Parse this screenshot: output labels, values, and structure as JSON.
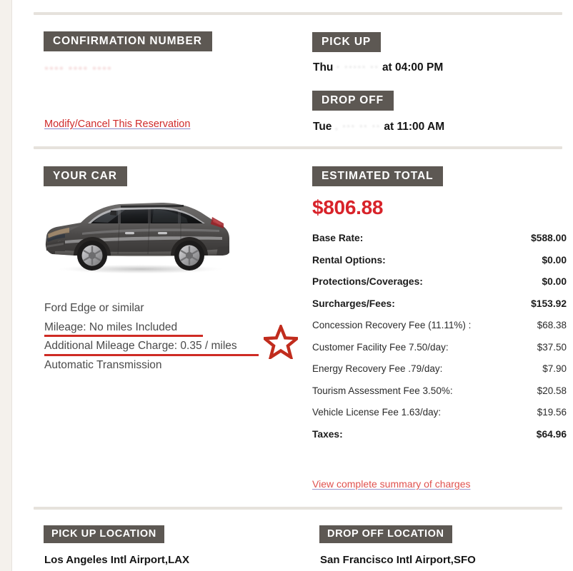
{
  "confirmation": {
    "badge_label": "CONFIRMATION NUMBER",
    "number_redacted": "•••• •••• ••••",
    "modify_link": "Modify/Cancel This Reservation"
  },
  "pickup": {
    "badge_label": "PICK UP",
    "weekday": "Thu",
    "date_redacted": "·  ····· ··",
    "time_text": "at 04:00 PM"
  },
  "dropoff": {
    "badge_label": "DROP OFF",
    "weekday": "Tue",
    "date_redacted": ".  ···  ·· ··",
    "time_text": "at 11:00 AM"
  },
  "your_car": {
    "badge_label": "YOUR CAR",
    "image_alt": "car-side-profile-suv",
    "model": "Ford Edge or similar",
    "mileage": "Mileage: No miles Included",
    "additional_mileage": "Additional Mileage Charge: 0.35 / miles",
    "transmission": "Automatic Transmission",
    "annotation_icon": "star-icon"
  },
  "estimated_total": {
    "badge_label": "ESTIMATED TOTAL",
    "total": "$806.88",
    "charges": [
      {
        "label": "Base Rate:",
        "amount": "$588.00",
        "emphasis": "main"
      },
      {
        "label": "Rental Options:",
        "amount": "$0.00",
        "emphasis": "main"
      },
      {
        "label": "Protections/Coverages:",
        "amount": "$0.00",
        "emphasis": "main"
      },
      {
        "label": "Surcharges/Fees:",
        "amount": "$153.92",
        "emphasis": "main"
      },
      {
        "label": "Concession Recovery Fee (11.11%) :",
        "amount": "$68.38",
        "emphasis": "sub"
      },
      {
        "label": "Customer Facility Fee 7.50/day:",
        "amount": "$37.50",
        "emphasis": "sub"
      },
      {
        "label": "Energy Recovery Fee .79/day:",
        "amount": "$7.90",
        "emphasis": "sub"
      },
      {
        "label": "Tourism Assessment Fee 3.50%:",
        "amount": "$20.58",
        "emphasis": "sub"
      },
      {
        "label": "Vehicle License Fee 1.63/day:",
        "amount": "$19.56",
        "emphasis": "sub"
      },
      {
        "label": "Taxes:",
        "amount": "$64.96",
        "emphasis": "main"
      }
    ],
    "summary_link": "View complete summary of charges"
  },
  "locations": {
    "pickup_badge_label": "PICK UP LOCATION",
    "pickup_name": "Los Angeles Intl Airport,LAX",
    "dropoff_badge_label": "DROP OFF LOCATION",
    "dropoff_name": "San Francisco Intl Airport,SFO"
  },
  "colors": {
    "badge_bg": "#5d5853",
    "total_red": "#d8232a",
    "link_red": "#d02b2b",
    "underline_red": "#cf2b24",
    "divider": "#e6e2dc",
    "page_bg": "#f4f1ec"
  }
}
